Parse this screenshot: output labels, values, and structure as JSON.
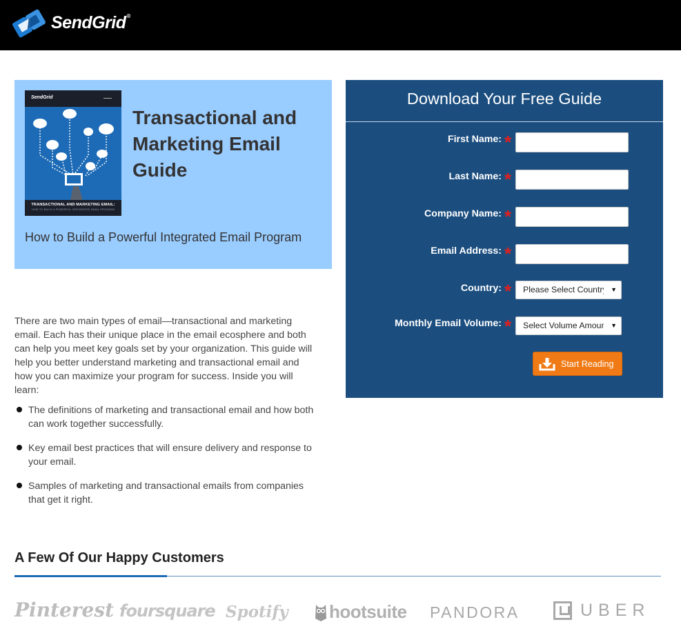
{
  "header": {
    "brand": "SendGrid",
    "trademark": "®",
    "colors": {
      "background": "#000000",
      "logo_blue": "#1d7bd1"
    }
  },
  "hero": {
    "cover": {
      "brand": "SendGrid",
      "title": "TRANSACTIONAL AND MARKETING EMAIL:",
      "subtitle": "HOW TO BUILD A POWERFUL INTEGRATED EMAIL PROGRAM"
    },
    "title": "Transactional and Marketing Email Guide",
    "subtitle": "How to Build a Powerful Integrated Email Program",
    "colors": {
      "background": "#99ccff"
    }
  },
  "content": {
    "intro": "There are two main types of email—transactional and marketing email. Each has their unique place in the email ecosphere and both can help you meet key goals set by your organization. This guide will help you better understand marketing and transactional email and how you can maximize your program for success. Inside you will learn:",
    "bullets": [
      "The definitions of marketing and transactional email and how both can work together successfully.",
      "Key email best practices that will ensure delivery and response to your email.",
      "Samples of marketing and transactional emails from companies that get it right."
    ]
  },
  "form": {
    "heading": "Download Your Free Guide",
    "required_marker": "*",
    "fields": {
      "first_name": {
        "label": "First Name:",
        "value": ""
      },
      "last_name": {
        "label": "Last Name:",
        "value": ""
      },
      "company": {
        "label": "Company Name:",
        "value": ""
      },
      "email": {
        "label": "Email Address:",
        "value": ""
      },
      "country": {
        "label": "Country:",
        "selected": "Please Select Country"
      },
      "volume": {
        "label": "Monthly Email Volume:",
        "selected": "Select Volume Amount"
      }
    },
    "submit_label": "Start Reading",
    "submit_icon": "download-icon",
    "colors": {
      "panel": "#1b4e7f",
      "button": "#f07b16",
      "required": "#e02020"
    }
  },
  "customers": {
    "title": "A Few Of Our Happy Customers",
    "logos": [
      "Pinterest",
      "foursquare",
      "Spotify",
      "hootsuite",
      "PANDORA",
      "UBER"
    ]
  }
}
